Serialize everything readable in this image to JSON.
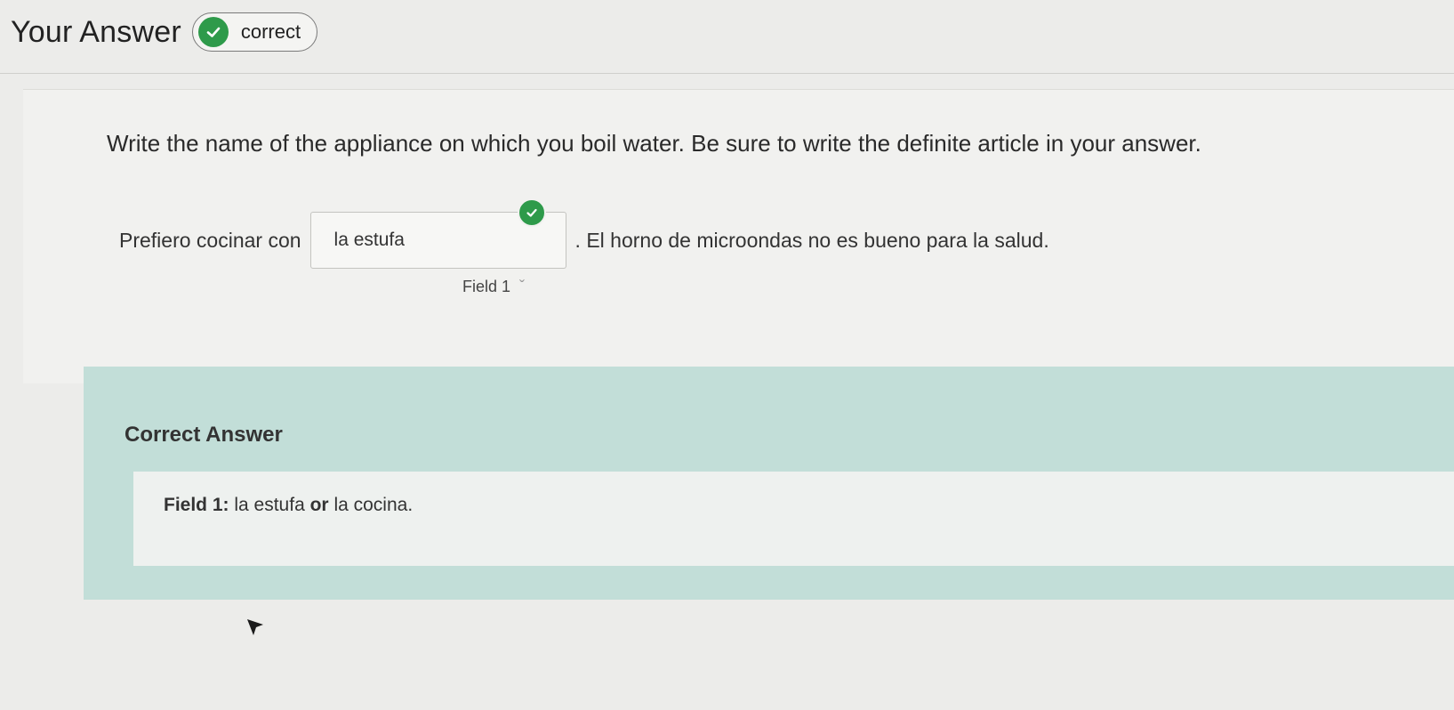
{
  "header": {
    "title": "Your Answer",
    "status_label": "correct",
    "status_icon": "check-circle-icon"
  },
  "question": {
    "prompt": "Write the name of the appliance on which you boil water. Be sure to write the definite article in your answer.",
    "sentence_before": "Prefiero cocinar con",
    "answer_value": "la estufa",
    "sentence_after": ". El horno de microondas no es bueno para la salud.",
    "field_label": "Field 1",
    "field_marker": "ˇ"
  },
  "correct_answer": {
    "title": "Correct Answer",
    "field_prefix": "Field 1:",
    "option_1": "la estufa",
    "or_word": "or",
    "option_2": "la cocina",
    "trailing": "."
  },
  "colors": {
    "success": "#2e9a4a",
    "correct_section_bg": "#c2ded8"
  }
}
